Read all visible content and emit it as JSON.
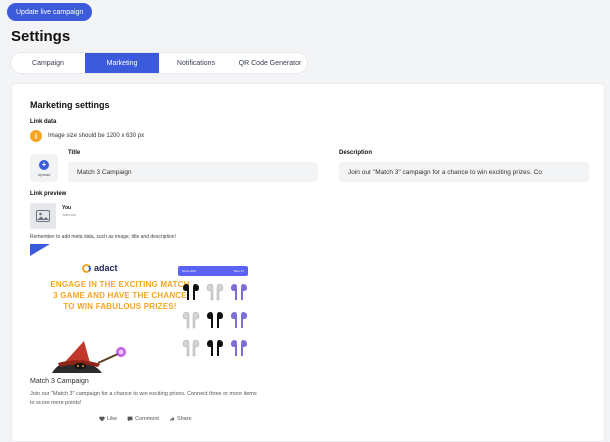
{
  "header": {
    "update_button": "Update live campaign",
    "title": "Settings"
  },
  "tabs": [
    {
      "label": "Campaign",
      "active": false
    },
    {
      "label": "Marketing",
      "active": true
    },
    {
      "label": "Notifications",
      "active": false
    },
    {
      "label": "QR Code Generator",
      "active": false
    }
  ],
  "marketing": {
    "section_title": "Marketing settings",
    "link_data_label": "Link data",
    "info_text": "Image size should be 1200 x 630 px",
    "upload_label": "Upload",
    "title_label": "Title",
    "title_value": "Match 3 Campaign",
    "description_label": "Description",
    "description_value": "Join our \"Match 3\" campaign for a chance to win exciting prizes. Co",
    "link_preview_label": "Link preview",
    "preview_name": "You",
    "preview_sub": "Just now",
    "reminder": "Remember to add meta data, such as image, title and description!"
  },
  "preview_image": {
    "brand": "adact",
    "headline": "ENGAGE IN THE EXCITING MATCH 3 GAME AND HAVE THE CHANCE TO WIN FABULOUS PRIZES!",
    "game_score": "Score 400",
    "game_time": "Time 37"
  },
  "post": {
    "title": "Match 3 Campaign",
    "description": "Join our \"Match 3\" campaign for a chance to win exciting prizes. Connect three or more items to score more points!",
    "like": "Like",
    "comment": "Comment",
    "share": "Share"
  },
  "colors": {
    "accent": "#3b5bdb",
    "orange": "#f5a524",
    "purple": "#7b6fd6"
  }
}
